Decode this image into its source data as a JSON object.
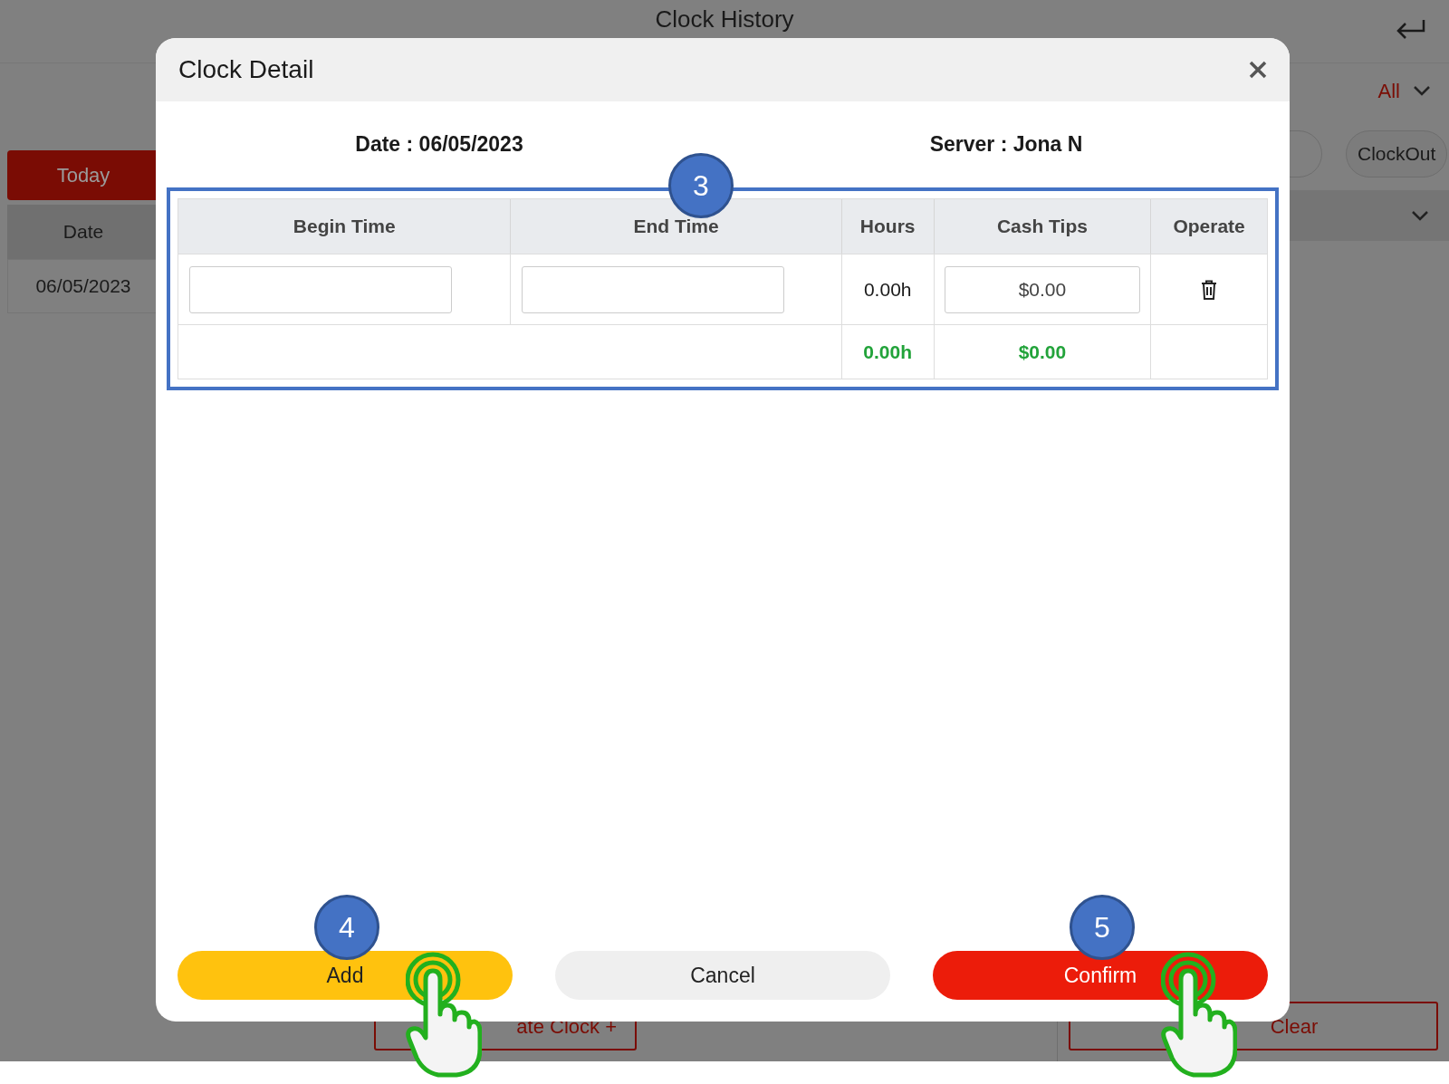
{
  "page": {
    "title": "Clock History",
    "today_button": "Today",
    "date_header": "Date",
    "date_rows": [
      "06/05/2023"
    ],
    "filter": "All",
    "clockout_button": "ClockOut",
    "bottom_buttons": [
      {
        "label": "ate Clock +",
        "kind": "create"
      },
      {
        "label": "Clear",
        "kind": "clear"
      }
    ]
  },
  "dialog": {
    "title": "Clock Detail",
    "date_label": "Date : 06/05/2023",
    "server_label": "Server : Jona N",
    "step": "3",
    "table": {
      "columns": [
        "Begin Time",
        "End Time",
        "Hours",
        "Cash Tips",
        "Operate"
      ],
      "rows": [
        {
          "hours": "0.00h",
          "cash_tips": "$0.00"
        }
      ],
      "totals": {
        "hours": "0.00h",
        "cash_tips": "$0.00"
      }
    },
    "buttons": [
      {
        "label": "Add",
        "kind": "add",
        "step": "4",
        "tapped": true
      },
      {
        "label": "Cancel",
        "kind": "cancel",
        "tapped": false
      },
      {
        "label": "Confirm",
        "kind": "confirm",
        "step": "5",
        "tapped": true
      }
    ]
  }
}
